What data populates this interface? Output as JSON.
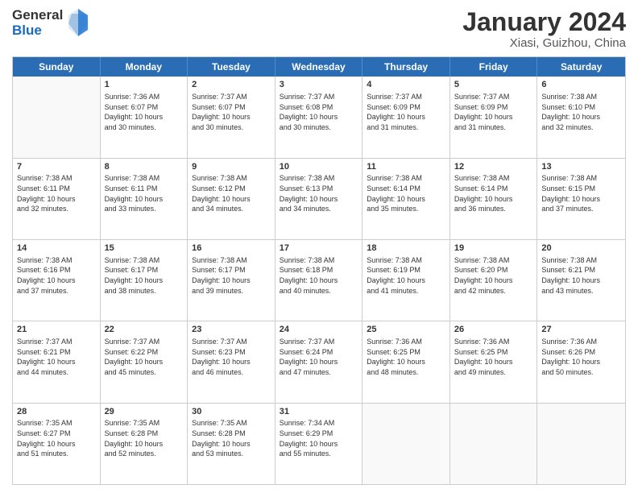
{
  "header": {
    "logo_line1": "General",
    "logo_line2": "Blue",
    "title": "January 2024",
    "subtitle": "Xiasi, Guizhou, China"
  },
  "days_of_week": [
    "Sunday",
    "Monday",
    "Tuesday",
    "Wednesday",
    "Thursday",
    "Friday",
    "Saturday"
  ],
  "weeks": [
    [
      {
        "day": "",
        "info": ""
      },
      {
        "day": "1",
        "info": "Sunrise: 7:36 AM\nSunset: 6:07 PM\nDaylight: 10 hours\nand 30 minutes."
      },
      {
        "day": "2",
        "info": "Sunrise: 7:37 AM\nSunset: 6:07 PM\nDaylight: 10 hours\nand 30 minutes."
      },
      {
        "day": "3",
        "info": "Sunrise: 7:37 AM\nSunset: 6:08 PM\nDaylight: 10 hours\nand 30 minutes."
      },
      {
        "day": "4",
        "info": "Sunrise: 7:37 AM\nSunset: 6:09 PM\nDaylight: 10 hours\nand 31 minutes."
      },
      {
        "day": "5",
        "info": "Sunrise: 7:37 AM\nSunset: 6:09 PM\nDaylight: 10 hours\nand 31 minutes."
      },
      {
        "day": "6",
        "info": "Sunrise: 7:38 AM\nSunset: 6:10 PM\nDaylight: 10 hours\nand 32 minutes."
      }
    ],
    [
      {
        "day": "7",
        "info": "Sunrise: 7:38 AM\nSunset: 6:11 PM\nDaylight: 10 hours\nand 32 minutes."
      },
      {
        "day": "8",
        "info": "Sunrise: 7:38 AM\nSunset: 6:11 PM\nDaylight: 10 hours\nand 33 minutes."
      },
      {
        "day": "9",
        "info": "Sunrise: 7:38 AM\nSunset: 6:12 PM\nDaylight: 10 hours\nand 34 minutes."
      },
      {
        "day": "10",
        "info": "Sunrise: 7:38 AM\nSunset: 6:13 PM\nDaylight: 10 hours\nand 34 minutes."
      },
      {
        "day": "11",
        "info": "Sunrise: 7:38 AM\nSunset: 6:14 PM\nDaylight: 10 hours\nand 35 minutes."
      },
      {
        "day": "12",
        "info": "Sunrise: 7:38 AM\nSunset: 6:14 PM\nDaylight: 10 hours\nand 36 minutes."
      },
      {
        "day": "13",
        "info": "Sunrise: 7:38 AM\nSunset: 6:15 PM\nDaylight: 10 hours\nand 37 minutes."
      }
    ],
    [
      {
        "day": "14",
        "info": "Sunrise: 7:38 AM\nSunset: 6:16 PM\nDaylight: 10 hours\nand 37 minutes."
      },
      {
        "day": "15",
        "info": "Sunrise: 7:38 AM\nSunset: 6:17 PM\nDaylight: 10 hours\nand 38 minutes."
      },
      {
        "day": "16",
        "info": "Sunrise: 7:38 AM\nSunset: 6:17 PM\nDaylight: 10 hours\nand 39 minutes."
      },
      {
        "day": "17",
        "info": "Sunrise: 7:38 AM\nSunset: 6:18 PM\nDaylight: 10 hours\nand 40 minutes."
      },
      {
        "day": "18",
        "info": "Sunrise: 7:38 AM\nSunset: 6:19 PM\nDaylight: 10 hours\nand 41 minutes."
      },
      {
        "day": "19",
        "info": "Sunrise: 7:38 AM\nSunset: 6:20 PM\nDaylight: 10 hours\nand 42 minutes."
      },
      {
        "day": "20",
        "info": "Sunrise: 7:38 AM\nSunset: 6:21 PM\nDaylight: 10 hours\nand 43 minutes."
      }
    ],
    [
      {
        "day": "21",
        "info": "Sunrise: 7:37 AM\nSunset: 6:21 PM\nDaylight: 10 hours\nand 44 minutes."
      },
      {
        "day": "22",
        "info": "Sunrise: 7:37 AM\nSunset: 6:22 PM\nDaylight: 10 hours\nand 45 minutes."
      },
      {
        "day": "23",
        "info": "Sunrise: 7:37 AM\nSunset: 6:23 PM\nDaylight: 10 hours\nand 46 minutes."
      },
      {
        "day": "24",
        "info": "Sunrise: 7:37 AM\nSunset: 6:24 PM\nDaylight: 10 hours\nand 47 minutes."
      },
      {
        "day": "25",
        "info": "Sunrise: 7:36 AM\nSunset: 6:25 PM\nDaylight: 10 hours\nand 48 minutes."
      },
      {
        "day": "26",
        "info": "Sunrise: 7:36 AM\nSunset: 6:25 PM\nDaylight: 10 hours\nand 49 minutes."
      },
      {
        "day": "27",
        "info": "Sunrise: 7:36 AM\nSunset: 6:26 PM\nDaylight: 10 hours\nand 50 minutes."
      }
    ],
    [
      {
        "day": "28",
        "info": "Sunrise: 7:35 AM\nSunset: 6:27 PM\nDaylight: 10 hours\nand 51 minutes."
      },
      {
        "day": "29",
        "info": "Sunrise: 7:35 AM\nSunset: 6:28 PM\nDaylight: 10 hours\nand 52 minutes."
      },
      {
        "day": "30",
        "info": "Sunrise: 7:35 AM\nSunset: 6:28 PM\nDaylight: 10 hours\nand 53 minutes."
      },
      {
        "day": "31",
        "info": "Sunrise: 7:34 AM\nSunset: 6:29 PM\nDaylight: 10 hours\nand 55 minutes."
      },
      {
        "day": "",
        "info": ""
      },
      {
        "day": "",
        "info": ""
      },
      {
        "day": "",
        "info": ""
      }
    ]
  ]
}
